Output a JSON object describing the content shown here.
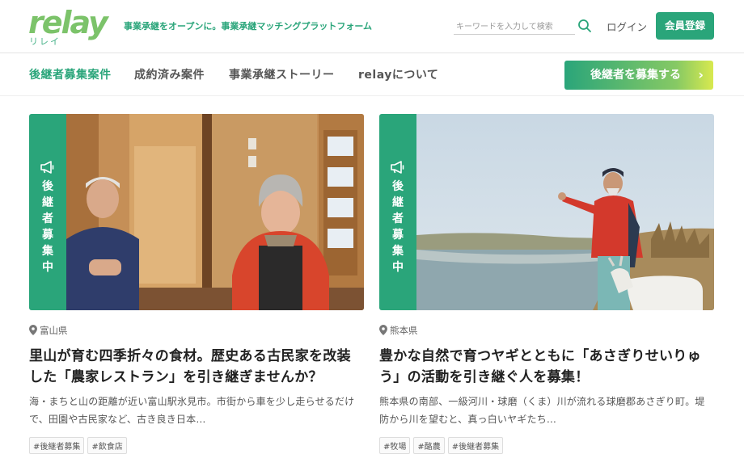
{
  "header": {
    "logo_text": "relay",
    "logo_sub": "リレイ",
    "tagline": "事業承継をオープンに。事業承継マッチングプラットフォーム",
    "search_placeholder": "キーワードを入力して検索",
    "search_value": "",
    "login_label": "ログイン",
    "register_label": "会員登録"
  },
  "nav": {
    "items": [
      {
        "label": "後継者募集案件",
        "active": true
      },
      {
        "label": "成約済み案件"
      },
      {
        "label": "事業承継ストーリー"
      },
      {
        "label": "relayについて"
      }
    ],
    "cta_label": "後継者を募集する",
    "cta_icon": "chevron-right-icon"
  },
  "colors": {
    "brand": "#2aa57a",
    "logo": "#7cc36a"
  },
  "cards": [
    {
      "badge": "後継者募集中",
      "location": "富山県",
      "title": "里山が育む四季折々の食材。歴史ある古民家を改装した「農家レストラン」を引き継ぎませんか？",
      "description": "海・まちと山の距離が近い富山駅氷見市。市街から車を少し走らせるだけで、田園や古民家など、古き良き日本…",
      "tags": [
        "#後継者募集",
        "#飲食店"
      ]
    },
    {
      "badge": "後継者募集中",
      "location": "熊本県",
      "title": "豊かな自然で育つヤギとともに「あさぎりせいりゅう」の活動を引き継ぐ人を募集！",
      "description": "熊本県の南部、一級河川・球磨（くま）川が流れる球磨郡あさぎり町。堤防から川を望むと、真っ白いヤギたち…",
      "tags": [
        "#牧場",
        "#酪農",
        "#後継者募集"
      ]
    }
  ]
}
